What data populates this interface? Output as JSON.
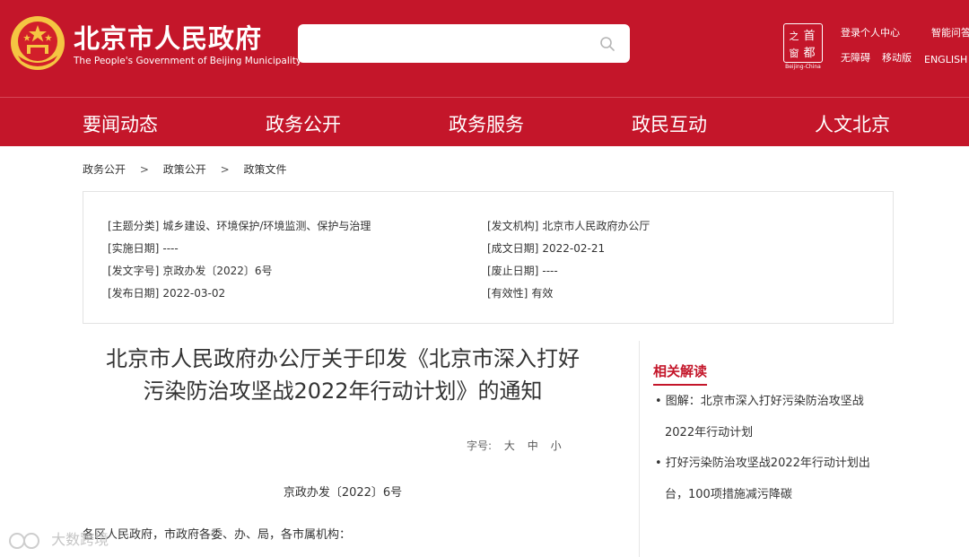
{
  "header": {
    "site_title": "北京市人民政府",
    "site_subtitle": "The People's Government of Beijing Municipality",
    "search_placeholder": "",
    "seal_chars": [
      "首",
      "都",
      "之",
      "窗"
    ],
    "seal_caption": "Beijing-China",
    "links": {
      "login": "登录个人中心",
      "smart_qa": "智能问答",
      "accessibility": "无障碍",
      "mobile": "移动版",
      "english": "ENGLISH"
    }
  },
  "nav": [
    "要闻动态",
    "政务公开",
    "政务服务",
    "政民互动",
    "人文北京"
  ],
  "breadcrumb": [
    "政务公开",
    "政策公开",
    "政策文件"
  ],
  "breadcrumb_sep": ">",
  "info": {
    "left": [
      {
        "key": "[主题分类]",
        "value": "城乡建设、环境保护/环境监测、保护与治理"
      },
      {
        "key": "[实施日期]",
        "value": "----"
      },
      {
        "key": "[发文字号]",
        "value": "京政办发〔2022〕6号"
      },
      {
        "key": "[发布日期]",
        "value": "2022-03-02"
      }
    ],
    "right": [
      {
        "key": "[发文机构]",
        "value": "北京市人民政府办公厅"
      },
      {
        "key": "[成文日期]",
        "value": "2022-02-21"
      },
      {
        "key": "[废止日期]",
        "value": "----"
      },
      {
        "key": "[有效性]",
        "value": "有效"
      }
    ]
  },
  "article": {
    "title_line1": "北京市人民政府办公厅关于印发《北京市深入打好",
    "title_line2": "污染防治攻坚战2022年行动计划》的通知",
    "font_size_label": "字号:",
    "font_sizes": [
      "大",
      "中",
      "小"
    ],
    "doc_number": "京政办发〔2022〕6号",
    "salutation": "各区人民政府，市政府各委、办、局，各市属机构："
  },
  "related": {
    "title": "相关解读",
    "items": [
      {
        "line1": "• 图解：北京市深入打好污染防治攻坚战",
        "line2": "2022年行动计划"
      },
      {
        "line1": "• 打好污染防治攻坚战2022年行动计划出",
        "line2": "台，100项措施减污降碳"
      }
    ]
  },
  "watermark": "大数跨境",
  "colors": {
    "brand_red": "#c4162a",
    "emblem_gold": "#f5c542"
  }
}
